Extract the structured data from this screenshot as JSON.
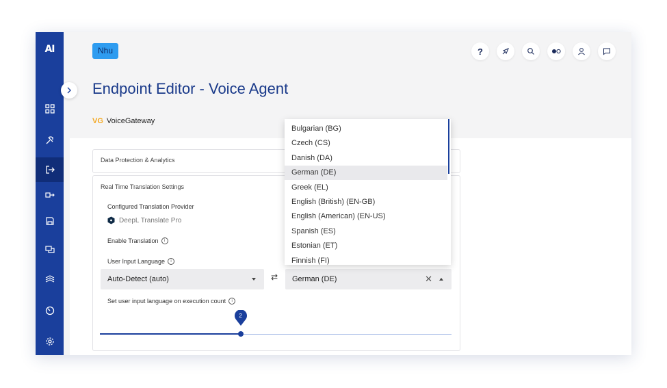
{
  "app": {
    "logo": "AI",
    "user_badge": "Nhu",
    "page_title": "Endpoint Editor - Voice Agent",
    "brand_prefix": "VG",
    "brand_name": "VoiceGateway"
  },
  "colors": {
    "sidebar": "#1a3f9c",
    "accent": "#2e9cf0",
    "title": "#1a3a8a",
    "brand_prefix": "#f4a821"
  },
  "sidebar": {
    "items": [
      {
        "icon": "dashboard-icon"
      },
      {
        "icon": "build-icon"
      },
      {
        "icon": "endpoint-icon",
        "active": true
      },
      {
        "icon": "transfer-icon"
      },
      {
        "icon": "save-icon"
      },
      {
        "icon": "conversations-icon"
      },
      {
        "icon": "layers-icon"
      },
      {
        "icon": "analytics-icon"
      },
      {
        "icon": "settings-icon"
      }
    ]
  },
  "header_icons": [
    "help-icon",
    "compass-icon",
    "search-icon",
    "toggle-icon",
    "user-icon",
    "chat-icon"
  ],
  "sections": {
    "data_protection": "Data Protection & Analytics",
    "translation": "Real Time Translation Settings"
  },
  "form": {
    "provider_label": "Configured Translation Provider",
    "provider_value": "DeepL Translate Pro",
    "enable_label": "Enable Translation",
    "input_language_label": "User Input Language",
    "source_language": "Auto-Detect (auto)",
    "target_language": "German (DE)",
    "execution_count_label": "Set user input language on execution count",
    "slider_value": 2,
    "slider_fraction": 0.4
  },
  "dropdown": {
    "options": [
      "Bulgarian (BG)",
      "Czech (CS)",
      "Danish (DA)",
      "German (DE)",
      "Greek (EL)",
      "English (British) (EN-GB)",
      "English (American) (EN-US)",
      "Spanish (ES)",
      "Estonian (ET)",
      "Finnish (FI)"
    ],
    "selected": "German (DE)"
  }
}
